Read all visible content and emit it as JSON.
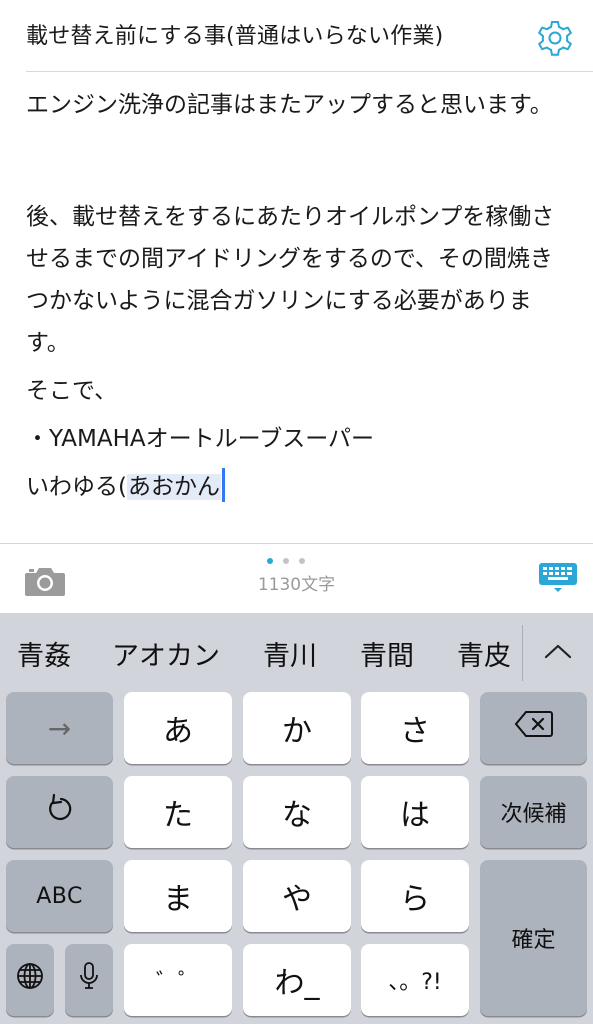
{
  "header": {
    "title": "載せ替え前にする事(普通はいらない作業)",
    "settings_icon": "gear-icon",
    "accent_color": "#2aa7d6"
  },
  "editor": {
    "paragraph1": "エンジン洗浄の記事はまたアップすると思います。",
    "paragraph2": "後、載せ替えをするにあたりオイルポンプを稼働させるまでの間アイドリングをするので、その間焼きつかないように混合ガソリンにする必要があります。",
    "paragraph3": "そこで、",
    "paragraph4": "・YAMAHAオートルーブスーパー",
    "paragraph5_prefix": "いわゆる(",
    "paragraph5_marked": "あおかん"
  },
  "toolbar": {
    "camera_icon": "camera-icon",
    "char_count": "1130文字",
    "keyboard_icon": "keyboard-icon",
    "page_dots": 3,
    "active_dot": 0
  },
  "candidates": {
    "items": [
      "青姦",
      "アオカン",
      "青川",
      "青間",
      "青皮"
    ],
    "toggle_icon": "chevron-up-icon"
  },
  "keyboard": {
    "arrow_key": "→",
    "undo_icon": "undo-icon",
    "abc_label": "ABC",
    "globe_icon": "globe-icon",
    "mic_icon": "microphone-icon",
    "delete_icon": "delete-icon",
    "next_candidate_label": "次候補",
    "confirm_label": "確定",
    "keys": [
      "あ",
      "か",
      "さ",
      "た",
      "な",
      "は",
      "ま",
      "や",
      "ら",
      "゛゜",
      "わ_",
      "、。?!"
    ]
  }
}
